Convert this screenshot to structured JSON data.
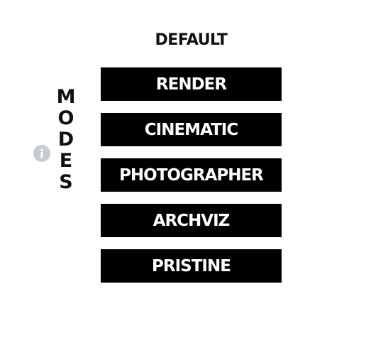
{
  "default_label": "DEFAULT",
  "modes_title": [
    "M",
    "O",
    "D",
    "E",
    "S"
  ],
  "info": {
    "icon": "info-icon"
  },
  "modes": [
    {
      "label": "RENDER"
    },
    {
      "label": "CINEMATIC"
    },
    {
      "label": "PHOTOGRAPHER"
    },
    {
      "label": "ARCHVIZ"
    },
    {
      "label": "PRISTINE"
    }
  ],
  "colors": {
    "button_bg": "#000000",
    "button_text": "#ffffff",
    "info_icon": "#c8cbd4",
    "text": "#111111"
  }
}
